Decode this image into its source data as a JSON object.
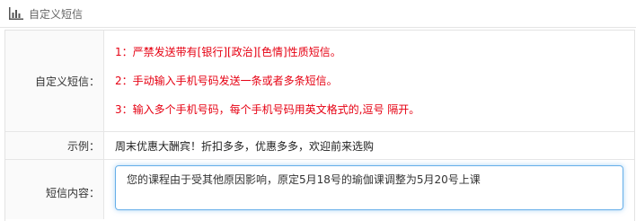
{
  "header": {
    "icon": "bar-chart-icon",
    "title": "自定义短信"
  },
  "form": {
    "rows": [
      {
        "label": "自定义短信：",
        "notes": [
          "1：严禁发送带有[银行][政治][色情]性质短信。",
          "2：手动输入手机号码发送一条或者多条短信。",
          "3：输入多个手机号码，每个手机号码用英文格式的,逗号 隔开。"
        ]
      },
      {
        "label": "示例：",
        "value": "周末优惠大酬宾！折扣多多，优惠多多，欢迎前来选购"
      },
      {
        "label": "短信内容：",
        "value": "您的课程由于受其他原因影响，原定5月18号的瑜伽课调整为5月20号上课"
      }
    ]
  },
  "colors": {
    "warning": "#e60012",
    "focus_border": "#66afe9"
  }
}
